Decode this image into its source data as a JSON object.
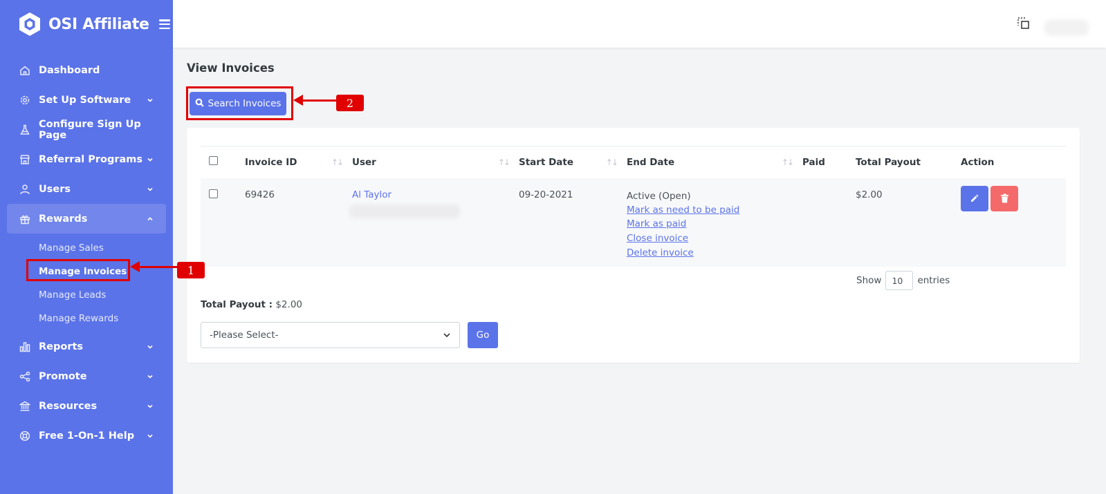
{
  "app": {
    "brand_name": "OSI Affiliate"
  },
  "sidebar": {
    "items": [
      {
        "label": "Dashboard",
        "icon": "home-icon",
        "has_chevron": false
      },
      {
        "label": "Set Up Software",
        "icon": "gear-icon",
        "has_chevron": true
      },
      {
        "label": "Configure Sign Up Page",
        "icon": "flask-icon",
        "has_chevron": false
      },
      {
        "label": "Referral Programs",
        "icon": "store-icon",
        "has_chevron": true
      },
      {
        "label": "Users",
        "icon": "user-icon",
        "has_chevron": true
      },
      {
        "label": "Rewards",
        "icon": "gift-icon",
        "has_chevron": true,
        "expanded": true
      },
      {
        "label": "Reports",
        "icon": "bar-chart-icon",
        "has_chevron": true
      },
      {
        "label": "Promote",
        "icon": "share-icon",
        "has_chevron": true
      },
      {
        "label": "Resources",
        "icon": "bank-icon",
        "has_chevron": true
      },
      {
        "label": "Free 1-On-1 Help",
        "icon": "lifebuoy-icon",
        "has_chevron": true
      }
    ],
    "rewards_sub": [
      {
        "label": "Manage Sales"
      },
      {
        "label": "Manage Invoices",
        "current": true
      },
      {
        "label": "Manage Leads"
      },
      {
        "label": "Manage Rewards"
      }
    ]
  },
  "page": {
    "title": "View Invoices",
    "search_button": "Search Invoices"
  },
  "table": {
    "columns": [
      "Invoice ID",
      "User",
      "Start Date",
      "End Date",
      "Paid",
      "Total Payout",
      "Action"
    ],
    "rows": [
      {
        "invoice_id": "69426",
        "user": "Al Taylor",
        "start_date": "09-20-2021",
        "end_status": "Active (Open)",
        "end_links": [
          "Mark as need to be paid",
          "Mark as paid",
          "Close invoice",
          "Delete invoice"
        ],
        "paid": "",
        "total_payout": "$2.00"
      }
    ]
  },
  "entries": {
    "show_label": "Show",
    "value": "10",
    "suffix": "entries"
  },
  "totals": {
    "label": "Total Payout :",
    "value": "$2.00"
  },
  "bulk": {
    "select_placeholder": "-Please Select-",
    "go_label": "Go"
  },
  "annotations": {
    "step1": "1",
    "step2": "2"
  },
  "colors": {
    "brand": "#5b73e8",
    "danger": "#f46a6a",
    "annotation": "#e00000"
  }
}
